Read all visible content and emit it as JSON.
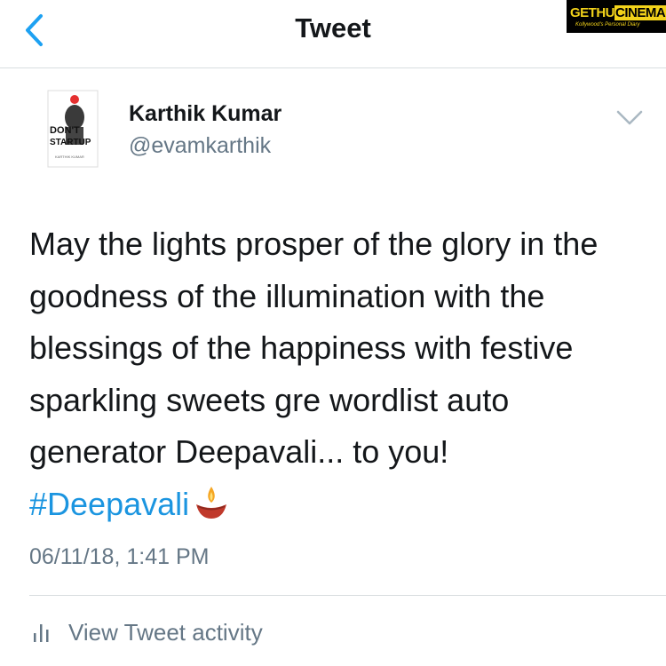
{
  "nav": {
    "title": "Tweet",
    "back_icon": "chevron-left-icon",
    "accent_color": "#1da1f2"
  },
  "watermark": {
    "brand_part1": "GETHU",
    "brand_part2": "CINEMA",
    "tagline": "Kollywood's Personal Diary"
  },
  "author": {
    "name": "Karthik Kumar",
    "handle": "@evamkarthik",
    "avatar": {
      "book_title_line1": "DON'T",
      "book_title_line2": "STARTUP",
      "book_author": "KARTHIK KUMAR"
    }
  },
  "tweet": {
    "lines": [
      "May the lights prosper of the glory in the",
      "goodness of the illumination with the",
      "blessings of the happiness with festive",
      "sparkling sweets gre wordlist auto",
      "generator Deepavali... to you!"
    ],
    "hashtag": "#Deepavali",
    "emoji": "diya-lamp-icon",
    "timestamp": "06/11/18, 1:41 PM",
    "hashtag_color": "#1b95e0"
  },
  "activity": {
    "label": "View Tweet activity",
    "icon": "bar-chart-icon"
  }
}
